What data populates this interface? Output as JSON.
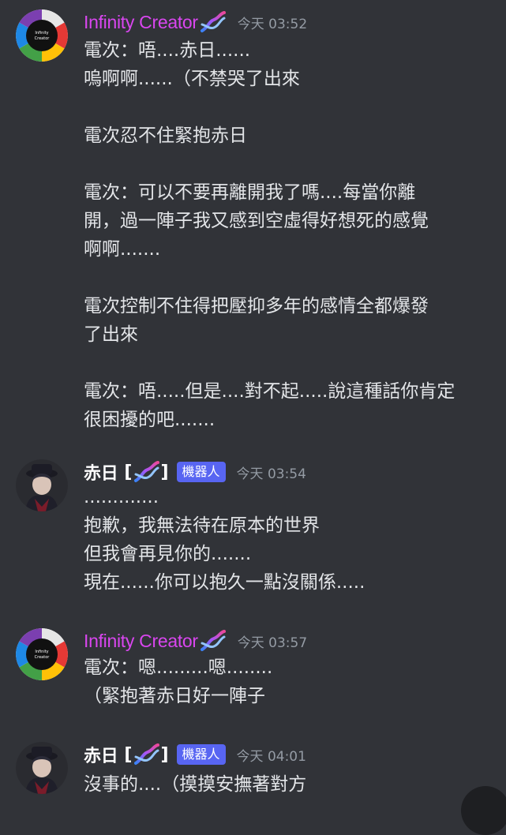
{
  "messages": [
    {
      "author": "Infinity Creator",
      "author_type": "creator",
      "avatar_text": "Infinity Creator",
      "timestamp": "今天 03:52",
      "lines": [
        "電次：唔....赤日......",
        "嗚啊啊......（不禁哭了出來",
        "",
        "電次忍不住緊抱赤日",
        "",
        "電次：可以不要再離開我了嗎....每當你離",
        "開，過一陣子我又感到空虛得好想死的感覺",
        "啊啊.......",
        "",
        "電次控制不住得把壓抑多年的感情全都爆發",
        "了出來",
        "",
        "電次：唔.....但是....對不起.....說這種話你肯定",
        "很困擾的吧......."
      ]
    },
    {
      "author": "赤日",
      "author_type": "bot",
      "bracket_open": "[",
      "bracket_close": "]",
      "bot_tag": "機器人",
      "timestamp": "今天 03:54",
      "lines": [
        ".............",
        "抱歉，我無法待在原本的世界",
        "但我會再見你的.......",
        "現在......你可以抱久一點沒關係....."
      ]
    },
    {
      "author": "Infinity Creator",
      "author_type": "creator",
      "avatar_text": "Infinity Creator",
      "timestamp": "今天 03:57",
      "lines": [
        "電次：嗯.........嗯........",
        "（緊抱著赤日好一陣子"
      ]
    },
    {
      "author": "赤日",
      "author_type": "bot",
      "bracket_open": "[",
      "bracket_close": "]",
      "bot_tag": "機器人",
      "timestamp": "今天 04:01",
      "lines": [
        "沒事的....（摸摸安撫著對方"
      ]
    }
  ],
  "colors": {
    "background": "#313338",
    "creator_name": "#d946ef",
    "bot_tag": "#5865f2",
    "timestamp": "#949ba4",
    "text": "#e3e5e8"
  }
}
